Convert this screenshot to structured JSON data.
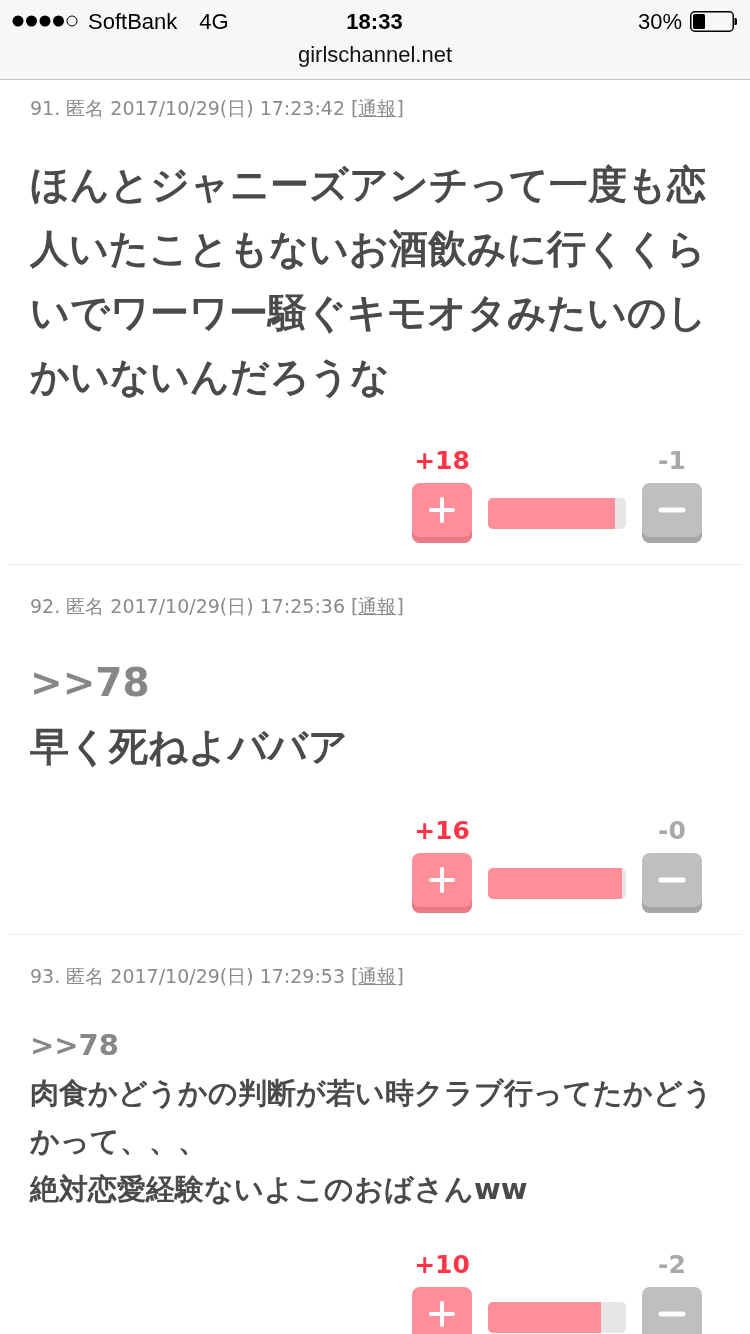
{
  "status_bar": {
    "carrier": "SoftBank",
    "network": "4G",
    "time": "18:33",
    "battery": "30%"
  },
  "address_bar": {
    "url": "girlschannel.net"
  },
  "comments": [
    {
      "meta": "91. 匿名 2017/10/29(日) 17:23:42 [",
      "report_link": "通報",
      "meta_end": "]",
      "large_text": true,
      "body": [
        "ほんとジャニーズアンチって一度も恋人いたこともないお酒飲みに行くくらいでワーワー騒ぐキモオタみたいのしかいないんだろうな"
      ],
      "votes": {
        "plus": "+18",
        "minus": "-1",
        "level": 0.92
      }
    },
    {
      "meta": "92. 匿名 2017/10/29(日) 17:25:36 [",
      "report_link": "通報",
      "meta_end": "]",
      "large_text": true,
      "reply_to": ">>78",
      "body": [
        "早く死ねよババア"
      ],
      "votes": {
        "plus": "+16",
        "minus": "-0",
        "level": 0.97
      }
    },
    {
      "meta": "93. 匿名 2017/10/29(日) 17:29:53 [",
      "report_link": "通報",
      "meta_end": "]",
      "large_text": false,
      "reply_to": ">>78",
      "body": [
        "肉食かどうかの判断が若い時クラブ行ってたかどうかって、、、",
        "絶対恋愛経験ないよこのおばさんww"
      ],
      "votes": {
        "plus": "+10",
        "minus": "-2",
        "level": 0.82
      }
    }
  ]
}
